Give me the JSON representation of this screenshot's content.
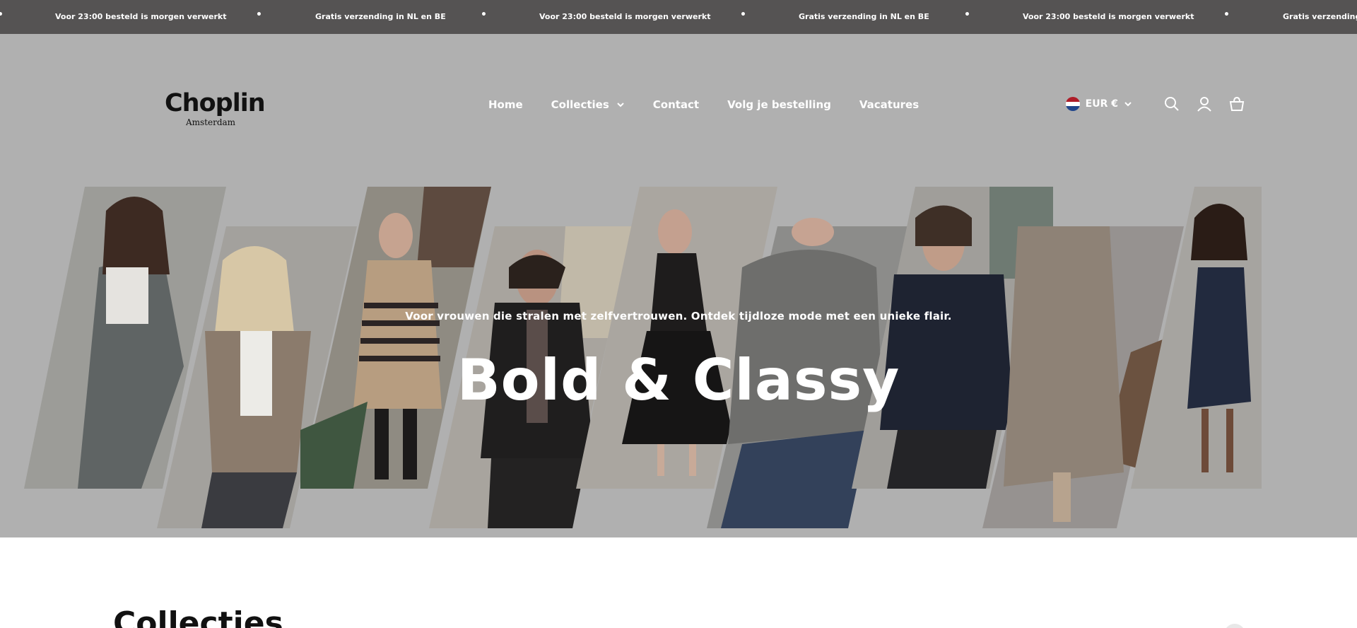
{
  "announcement": {
    "messages": [
      "Voor 23:00 besteld is morgen verwerkt",
      "Gratis verzending in NL en BE",
      "Voor 23:00 besteld is morgen verwerkt",
      "Gratis verzending in NL en BE",
      "Voor 23:00 besteld is morgen verwerkt",
      "Gratis verzending in"
    ],
    "separator": "•"
  },
  "header": {
    "logo": {
      "brand": "Choplin",
      "sub": "Amsterdam"
    },
    "nav": [
      {
        "label": "Home"
      },
      {
        "label": "Collecties"
      },
      {
        "label": "Contact"
      },
      {
        "label": "Volg je bestelling"
      },
      {
        "label": "Vacatures"
      }
    ],
    "currency": "EUR €",
    "icons": [
      "search-icon",
      "account-icon",
      "cart-icon"
    ]
  },
  "hero": {
    "tagline": "Voor vrouwen die stralen met zelfvertrouwen. Ontdek tijdloze mode met een unieke flair.",
    "headline": "Bold & Classy"
  },
  "collections": {
    "title": "Collecties"
  },
  "colors": {
    "announcement_bg": "#555353",
    "hero_overlay": "#b0b0b0",
    "text_light": "#ffffff"
  }
}
